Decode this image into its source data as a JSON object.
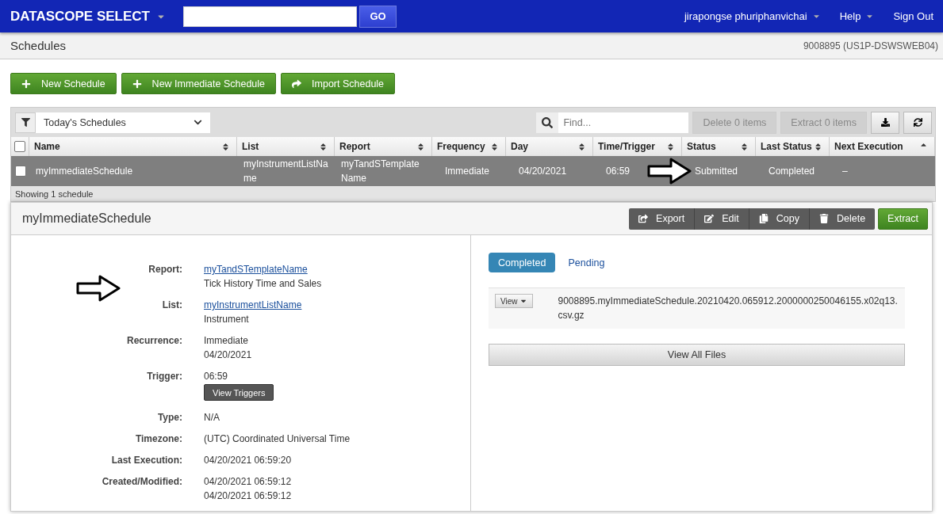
{
  "header": {
    "brand": "DATASCOPE SELECT",
    "search_button": "GO",
    "user": "jirapongse phuriphanvichai",
    "help": "Help",
    "sign_out": "Sign Out"
  },
  "subheader": {
    "title": "Schedules",
    "server": "9008895 (US1P-DSWSWEB04)"
  },
  "actions": [
    {
      "label": "New Schedule"
    },
    {
      "label": "New Immediate Schedule"
    },
    {
      "label": "Import Schedule"
    }
  ],
  "table": {
    "filter": "Today's Schedules",
    "search_placeholder": "Find...",
    "toolbar_buttons": [
      {
        "label": "Delete 0 items",
        "disabled": true
      },
      {
        "label": "Extract 0 items",
        "disabled": true
      }
    ],
    "header_checked": false,
    "columns": [
      {
        "label": "Name",
        "sorted": false
      },
      {
        "label": "List",
        "sorted": false
      },
      {
        "label": "Report",
        "sorted": false
      },
      {
        "label": "Frequency",
        "sorted": false
      },
      {
        "label": "Day",
        "sorted": false
      },
      {
        "label": "Time/Trigger",
        "sorted": false
      },
      {
        "label": "Status",
        "sorted": false
      },
      {
        "label": "Last Status",
        "sorted": false
      },
      {
        "label": "Next Execution",
        "sorted": true
      }
    ],
    "rows": [
      {
        "selected": true,
        "checked": false,
        "cells": [
          "myImmediateSchedule",
          "myInstrumentListName",
          "myTandSTemplateName",
          "Immediate",
          "04/20/2021",
          "06:59",
          "Submitted",
          "Completed",
          "–"
        ]
      }
    ],
    "footer": "Showing 1 schedule"
  },
  "detail": {
    "title": "myImmediateSchedule",
    "actions": [
      {
        "label": "Export",
        "kind": "dark"
      },
      {
        "label": "Edit",
        "kind": "dark"
      },
      {
        "label": "Copy",
        "kind": "dark"
      },
      {
        "label": "Delete",
        "kind": "dark"
      },
      {
        "label": "Extract",
        "kind": "primary"
      }
    ],
    "fields": [
      {
        "label": "Report:",
        "lines": [
          {
            "kind": "link",
            "text": "myTandSTemplateName"
          },
          {
            "kind": "text",
            "text": "Tick History Time and Sales"
          }
        ]
      },
      {
        "label": "List:",
        "lines": [
          {
            "kind": "link",
            "text": "myInstrumentListName"
          },
          {
            "kind": "text",
            "text": "Instrument"
          }
        ]
      },
      {
        "label": "Recurrence:",
        "lines": [
          {
            "kind": "text",
            "text": "Immediate"
          },
          {
            "kind": "text",
            "text": "04/20/2021"
          }
        ]
      },
      {
        "label": "Trigger:",
        "lines": [
          {
            "kind": "text",
            "text": "06:59"
          },
          {
            "kind": "button",
            "text": "View Triggers"
          }
        ]
      },
      {
        "label": "Type:",
        "lines": [
          {
            "kind": "text",
            "text": "N/A"
          }
        ]
      },
      {
        "label": "Timezone:",
        "lines": [
          {
            "kind": "text",
            "text": "(UTC) Coordinated Universal Time"
          }
        ]
      },
      {
        "label": "Last Execution:",
        "lines": [
          {
            "kind": "text",
            "text": "04/20/2021 06:59:20"
          }
        ]
      },
      {
        "label": "Created/Modified:",
        "lines": [
          {
            "kind": "text",
            "text": "04/20/2021 06:59:12"
          },
          {
            "kind": "text",
            "text": "04/20/2021 06:59:12"
          }
        ]
      }
    ],
    "tabs": [
      {
        "label": "Completed",
        "selected": true
      },
      {
        "label": "Pending",
        "selected": false
      }
    ],
    "files": [
      {
        "action": "View",
        "name": "9008895.myImmediateSchedule.20210420.065912.2000000250046155.x02q13.csv.gz"
      }
    ],
    "view_all": "View All Files"
  }
}
